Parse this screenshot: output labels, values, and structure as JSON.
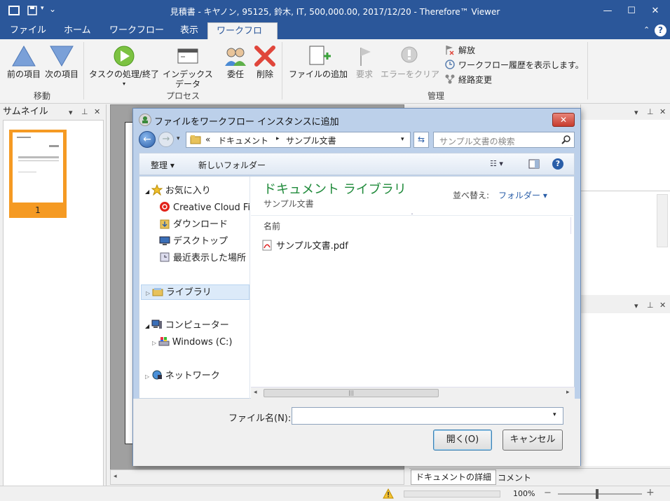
{
  "window": {
    "title": "見積書 - キヤノン, 95125, 鈴木, IT, 500,000.00, 2017/12/20 - Therefore™ Viewer",
    "min": "—",
    "max": "☐",
    "close": "✕"
  },
  "tabs": [
    {
      "label": "ファイル"
    },
    {
      "label": "ホーム"
    },
    {
      "label": "ワークフロー"
    },
    {
      "label": "表示"
    },
    {
      "label": "ワークフロー"
    }
  ],
  "ribbon": {
    "move": {
      "prev": "前の項目",
      "next": "次の項目",
      "group": "移動"
    },
    "process": {
      "task": "タスクの処理/終了",
      "index1": "インデックス",
      "index2": "データ",
      "group": "プロセス"
    },
    "delegate": "委任",
    "delete": "削除",
    "manage": {
      "add_file": "ファイルの追加",
      "request": "要求",
      "clear_error": "エラーをクリア",
      "group": "管理",
      "release": "解放",
      "history": "ワークフロー履歴を表示します。",
      "reroute": "経路変更"
    }
  },
  "thumbnail_panel": {
    "title": "サムネイル",
    "page_number": "1"
  },
  "dialog": {
    "title": "ファイルをワークフロー インスタンスに追加",
    "breadcrumb": {
      "prefix": "«",
      "part1": "ドキュメント",
      "sep": "▸",
      "part2": "サンプル文書"
    },
    "search_placeholder": "サンプル文書の検索",
    "toolbar": {
      "organize": "整理 ▾",
      "new_folder": "新しいフォルダー"
    },
    "nav": {
      "favorites": "お気に入り",
      "creative_cloud": "Creative Cloud Files",
      "downloads": "ダウンロード",
      "desktop": "デスクトップ",
      "recent": "最近表示した場所",
      "libraries": "ライブラリ",
      "computer": "コンピューター",
      "windows_c": "Windows (C:)",
      "network": "ネットワーク"
    },
    "library_title": "ドキュメント ライブラリ",
    "library_sub": "サンプル文書",
    "sort_label": "並べ替え:",
    "sort_value": "フォルダー ▾",
    "column_name": "名前",
    "files": [
      "サンプル文書.pdf"
    ],
    "filename_label": "ファイル名(N):",
    "filename_value": "",
    "open_button": "開く(O)",
    "cancel_button": "キャンセル"
  },
  "bottom": {
    "details_tab": "ドキュメントの詳細",
    "comment_tab": "コメント",
    "zoom": "100%"
  }
}
